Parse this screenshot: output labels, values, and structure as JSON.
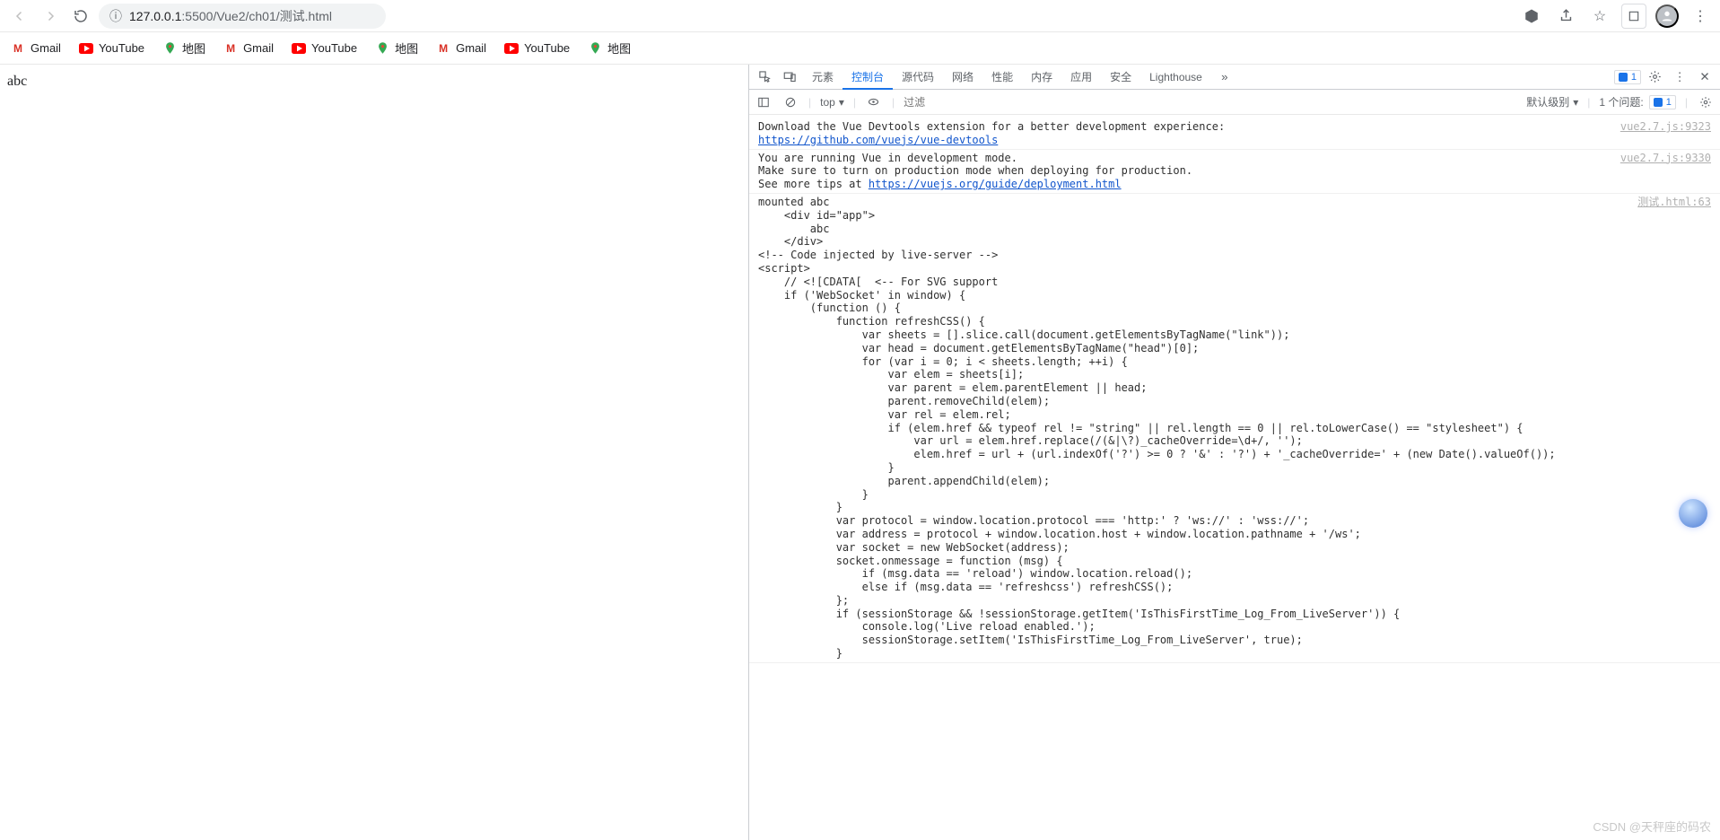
{
  "browser": {
    "url_host": "127.0.0.1",
    "url_port": ":5500",
    "url_path": "/Vue2/ch01/测试.html"
  },
  "bookmarks": [
    {
      "icon": "gmail",
      "label": "Gmail"
    },
    {
      "icon": "youtube",
      "label": "YouTube"
    },
    {
      "icon": "maps",
      "label": "地图"
    },
    {
      "icon": "gmail",
      "label": "Gmail"
    },
    {
      "icon": "youtube",
      "label": "YouTube"
    },
    {
      "icon": "maps",
      "label": "地图"
    },
    {
      "icon": "gmail",
      "label": "Gmail"
    },
    {
      "icon": "youtube",
      "label": "YouTube"
    },
    {
      "icon": "maps",
      "label": "地图"
    }
  ],
  "page": {
    "content": "abc"
  },
  "devtools": {
    "tabs": [
      "元素",
      "控制台",
      "源代码",
      "网络",
      "性能",
      "内存",
      "应用",
      "安全",
      "Lighthouse"
    ],
    "active_tab": "控制台",
    "issues_badge": "1",
    "toolbar": {
      "context": "top",
      "filter_placeholder": "过滤",
      "level": "默认级别",
      "issues_label": "1 个问题:",
      "issues_count": "1"
    },
    "console_source_1": "vue2.7.js:9323",
    "console_source_2": "vue2.7.js:9330",
    "console_source_3": "测试.html:63",
    "log1_text": "Download the Vue Devtools extension for a better development experience:\n",
    "log1_link": "https://github.com/vuejs/vue-devtools",
    "log2_text": "You are running Vue in development mode.\nMake sure to turn on production mode when deploying for production.\nSee more tips at ",
    "log2_link": "https://vuejs.org/guide/deployment.html",
    "log3_text": "mounted abc\n    <div id=\"app\">\n        abc\n    </div>\n<!-- Code injected by live-server -->\n<script>\n    // <![CDATA[  <-- For SVG support\n    if ('WebSocket' in window) {\n        (function () {\n            function refreshCSS() {\n                var sheets = [].slice.call(document.getElementsByTagName(\"link\"));\n                var head = document.getElementsByTagName(\"head\")[0];\n                for (var i = 0; i < sheets.length; ++i) {\n                    var elem = sheets[i];\n                    var parent = elem.parentElement || head;\n                    parent.removeChild(elem);\n                    var rel = elem.rel;\n                    if (elem.href && typeof rel != \"string\" || rel.length == 0 || rel.toLowerCase() == \"stylesheet\") {\n                        var url = elem.href.replace(/(&|\\?)_cacheOverride=\\d+/, '');\n                        elem.href = url + (url.indexOf('?') >= 0 ? '&' : '?') + '_cacheOverride=' + (new Date().valueOf());\n                    }\n                    parent.appendChild(elem);\n                }\n            }\n            var protocol = window.location.protocol === 'http:' ? 'ws://' : 'wss://';\n            var address = protocol + window.location.host + window.location.pathname + '/ws';\n            var socket = new WebSocket(address);\n            socket.onmessage = function (msg) {\n                if (msg.data == 'reload') window.location.reload();\n                else if (msg.data == 'refreshcss') refreshCSS();\n            };\n            if (sessionStorage && !sessionStorage.getItem('IsThisFirstTime_Log_From_LiveServer')) {\n                console.log('Live reload enabled.');\n                sessionStorage.setItem('IsThisFirstTime_Log_From_LiveServer', true);\n            }"
  },
  "watermark": "CSDN @天秤座的码农"
}
